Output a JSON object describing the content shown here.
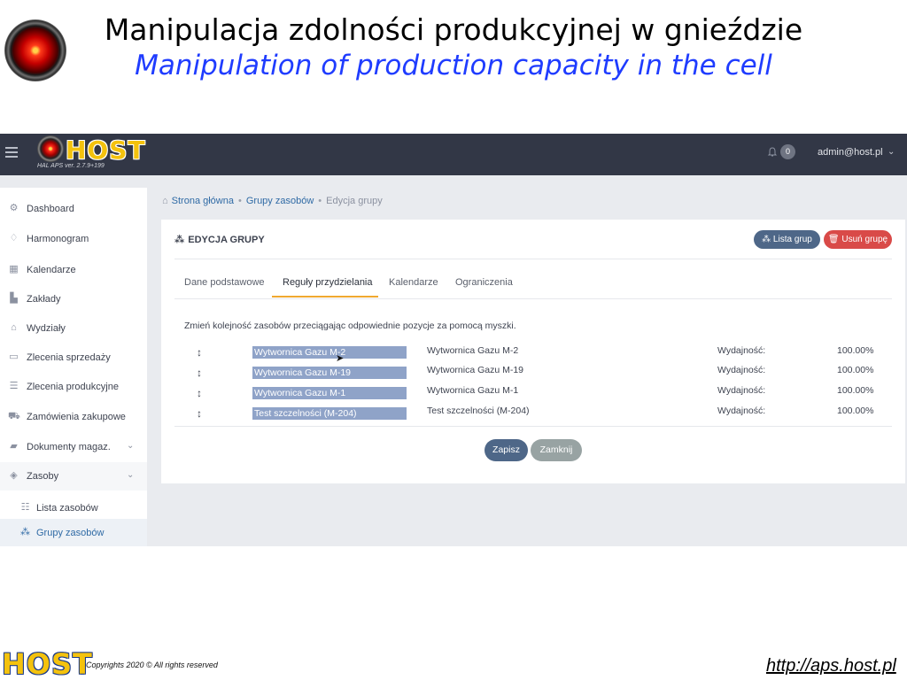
{
  "slide": {
    "title_pl": "Manipulacja zdolności produkcyjnej w gnieździe",
    "title_en": "Manipulation of production capacity in the cell",
    "footer_logo": "HOST",
    "copyright": "Copyrights 2020  © All rights reserved",
    "url": "http://aps.host.pl"
  },
  "app": {
    "brand": "HOST",
    "version": "HAL APS ver. 2.7.9+199",
    "notifications": "0",
    "user": "admin@host.pl"
  },
  "sidebar": {
    "items": [
      {
        "icon": "dashboard-icon",
        "label": "Dashboard"
      },
      {
        "icon": "schedule-icon",
        "label": "Harmonogram"
      },
      {
        "icon": "calendar-icon",
        "label": "Kalendarze"
      },
      {
        "icon": "factory-icon",
        "label": "Zakłady"
      },
      {
        "icon": "building-icon",
        "label": "Wydziały"
      },
      {
        "icon": "credit-card-icon",
        "label": "Zlecenia sprzedaży"
      },
      {
        "icon": "list-icon",
        "label": "Zlecenia produkcyjne"
      },
      {
        "icon": "cart-icon",
        "label": "Zamówienia zakupowe"
      },
      {
        "icon": "folder-icon",
        "label": "Dokumenty magaz."
      },
      {
        "icon": "cube-icon",
        "label": "Zasoby"
      }
    ],
    "subitems": [
      {
        "icon": "list-icon",
        "label": "Lista zasobów"
      },
      {
        "icon": "cubes-icon",
        "label": "Grupy zasobów"
      }
    ]
  },
  "breadcrumb": {
    "home": "Strona główna",
    "groups": "Grupy zasobów",
    "current": "Edycja grupy"
  },
  "card": {
    "title": "EDYCJA GRUPY",
    "list_button": "Lista grup",
    "delete_button": "Usuń grupę",
    "tabs": [
      "Dane podstawowe",
      "Reguły przydzielania",
      "Kalendarze",
      "Ograniczenia"
    ],
    "active_tab": "Reguły przydzielania",
    "hint": "Zmień kolejność zasobów przeciągając odpowiednie pozycje za pomocą myszki.",
    "rows": [
      {
        "chip": "Wytwornica Gazu M-2",
        "name": "Wytwornica Gazu M-2",
        "metric": "Wydajność:",
        "value": "100.00%"
      },
      {
        "chip": "Wytwornica Gazu M-19",
        "name": "Wytwornica Gazu M-19",
        "metric": "Wydajność:",
        "value": "100.00%"
      },
      {
        "chip": "Wytwornica Gazu M-1",
        "name": "Wytwornica Gazu M-1",
        "metric": "Wydajność:",
        "value": "100.00%"
      },
      {
        "chip": "Test szczelności (M-204)",
        "name": "Test szczelności (M-204)",
        "metric": "Wydajność:",
        "value": "100.00%"
      }
    ],
    "save_button": "Zapisz",
    "close_button": "Zamknij"
  }
}
